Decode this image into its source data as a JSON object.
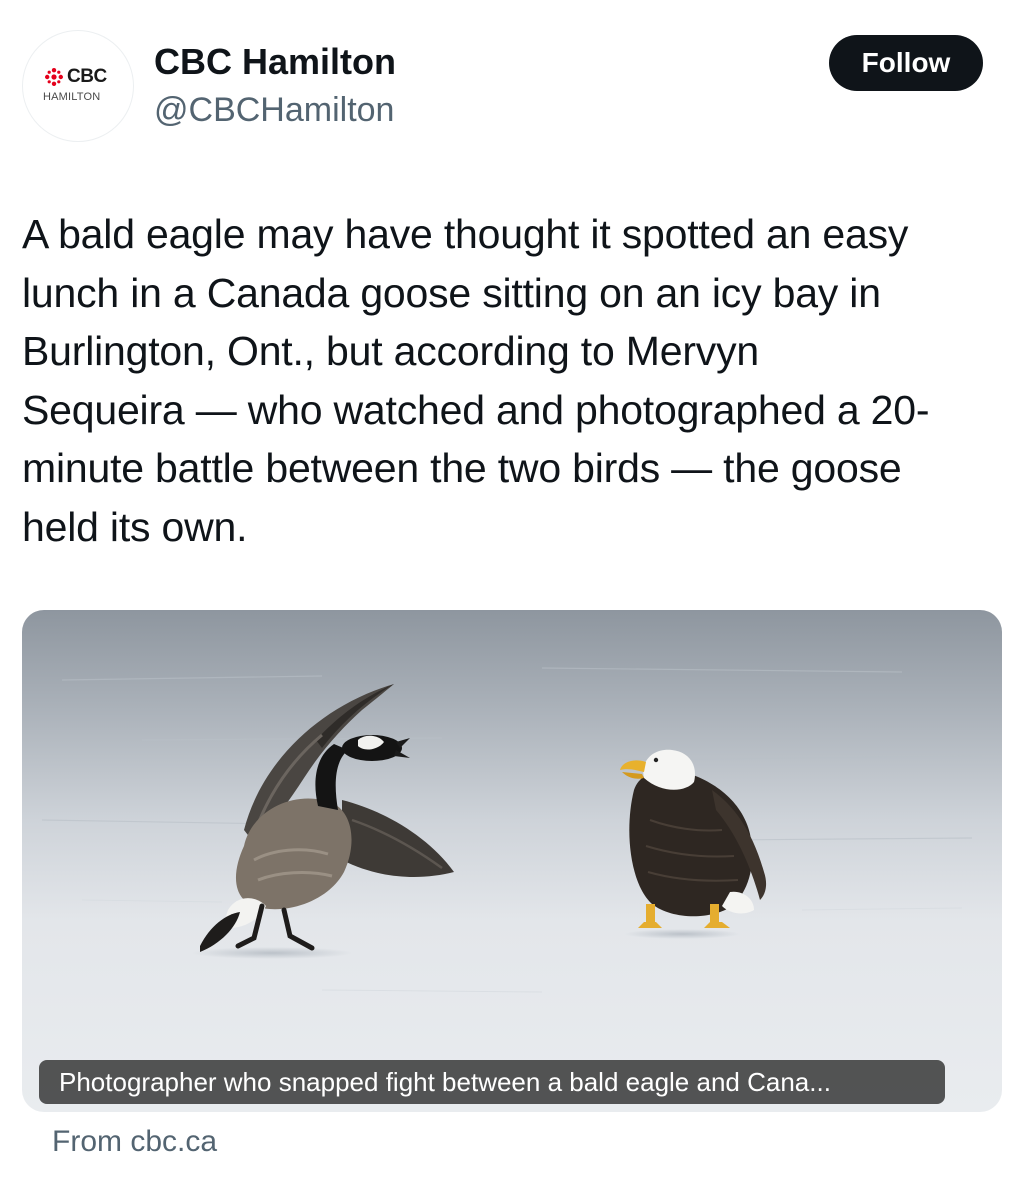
{
  "account": {
    "display_name": "CBC Hamilton",
    "handle": "@CBCHamilton",
    "avatar_logo_text": "CBC",
    "avatar_logo_sub": "HAMILTON"
  },
  "follow_button": {
    "label": "Follow"
  },
  "tweet": {
    "text": "A bald eagle may have thought it spotted an easy\nlunch in a Canada goose sitting on an icy bay in\nBurlington, Ont., but according to Mervyn\nSequeira — who watched and photographed a 20-\nminute battle between the two birds — the goose\nheld its own."
  },
  "link_card": {
    "caption": "Photographer who snapped fight between a bald eagle and Cana...",
    "source": "From cbc.ca",
    "image_subject": "bald-eagle-and-canada-goose-on-ice-photo"
  },
  "colors": {
    "text_primary": "#0f1419",
    "text_secondary": "#536471",
    "button_bg": "#0f1419",
    "cbc_red": "#e4001b"
  }
}
